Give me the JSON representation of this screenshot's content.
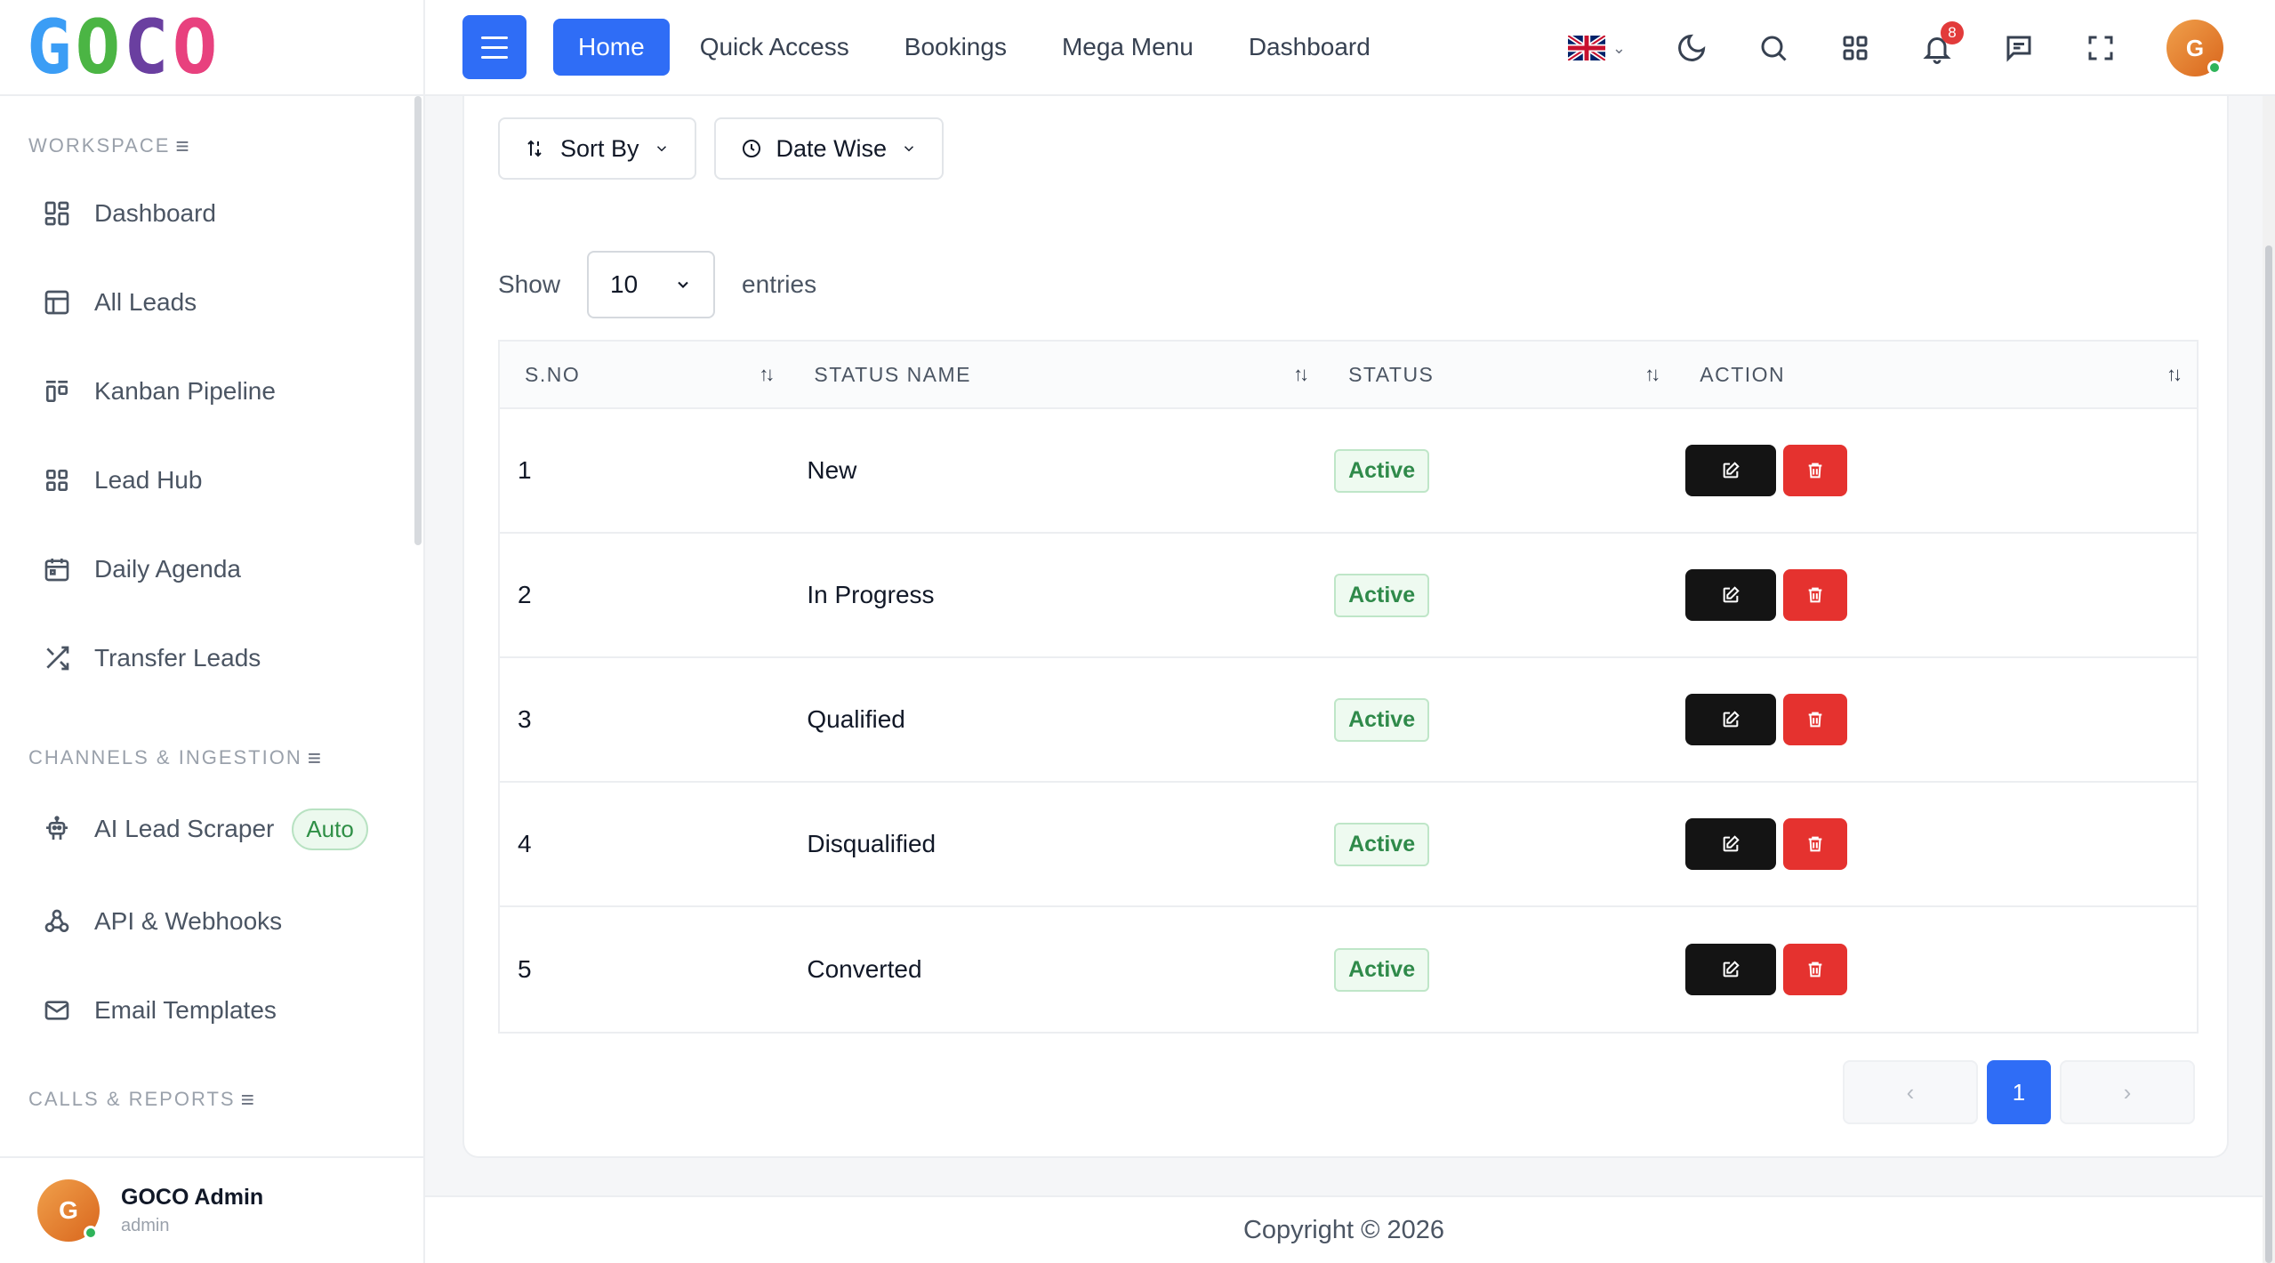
{
  "brand": {
    "logo_letters": [
      "G",
      "O",
      "C",
      "O"
    ],
    "colors": [
      "#3b9df5",
      "#4bb544",
      "#6a3fa0",
      "#e8417e"
    ]
  },
  "sidebar": {
    "sections": [
      {
        "title": "WORKSPACE",
        "items": [
          {
            "label": "Dashboard",
            "icon": "dashboard-icon"
          },
          {
            "label": "All Leads",
            "icon": "table-icon"
          },
          {
            "label": "Kanban Pipeline",
            "icon": "kanban-icon"
          },
          {
            "label": "Lead Hub",
            "icon": "grid-icon"
          },
          {
            "label": "Daily Agenda",
            "icon": "calendar-icon"
          },
          {
            "label": "Transfer Leads",
            "icon": "shuffle-icon"
          }
        ]
      },
      {
        "title": "CHANNELS & INGESTION",
        "items": [
          {
            "label": "AI Lead Scraper",
            "icon": "robot-icon",
            "badge": "Auto"
          },
          {
            "label": "API & Webhooks",
            "icon": "webhook-icon"
          },
          {
            "label": "Email Templates",
            "icon": "mail-icon"
          }
        ]
      },
      {
        "title": "CALLS & REPORTS",
        "items": []
      }
    ],
    "user": {
      "initial": "G",
      "name": "GOCO Admin",
      "role": "admin"
    }
  },
  "header": {
    "tabs": [
      "Home",
      "Quick Access",
      "Bookings",
      "Mega Menu",
      "Dashboard"
    ],
    "active_tab": "Home",
    "notification_count": "8",
    "avatar_initial": "G",
    "accent": "#2f6df6"
  },
  "filters": {
    "sort_label": "Sort By",
    "date_label": "Date Wise"
  },
  "entries": {
    "show_label": "Show",
    "value": "10",
    "suffix": "entries"
  },
  "table": {
    "columns": [
      "S.NO",
      "STATUS NAME",
      "STATUS",
      "ACTION"
    ],
    "rows": [
      {
        "sno": "1",
        "name": "New",
        "status": "Active"
      },
      {
        "sno": "2",
        "name": "In Progress",
        "status": "Active"
      },
      {
        "sno": "3",
        "name": "Qualified",
        "status": "Active"
      },
      {
        "sno": "4",
        "name": "Disqualified",
        "status": "Active"
      },
      {
        "sno": "5",
        "name": "Converted",
        "status": "Active"
      }
    ]
  },
  "pagination": {
    "prev": "‹",
    "current": "1",
    "next": "›"
  },
  "footer": {
    "copyright": "Copyright © 2026"
  }
}
